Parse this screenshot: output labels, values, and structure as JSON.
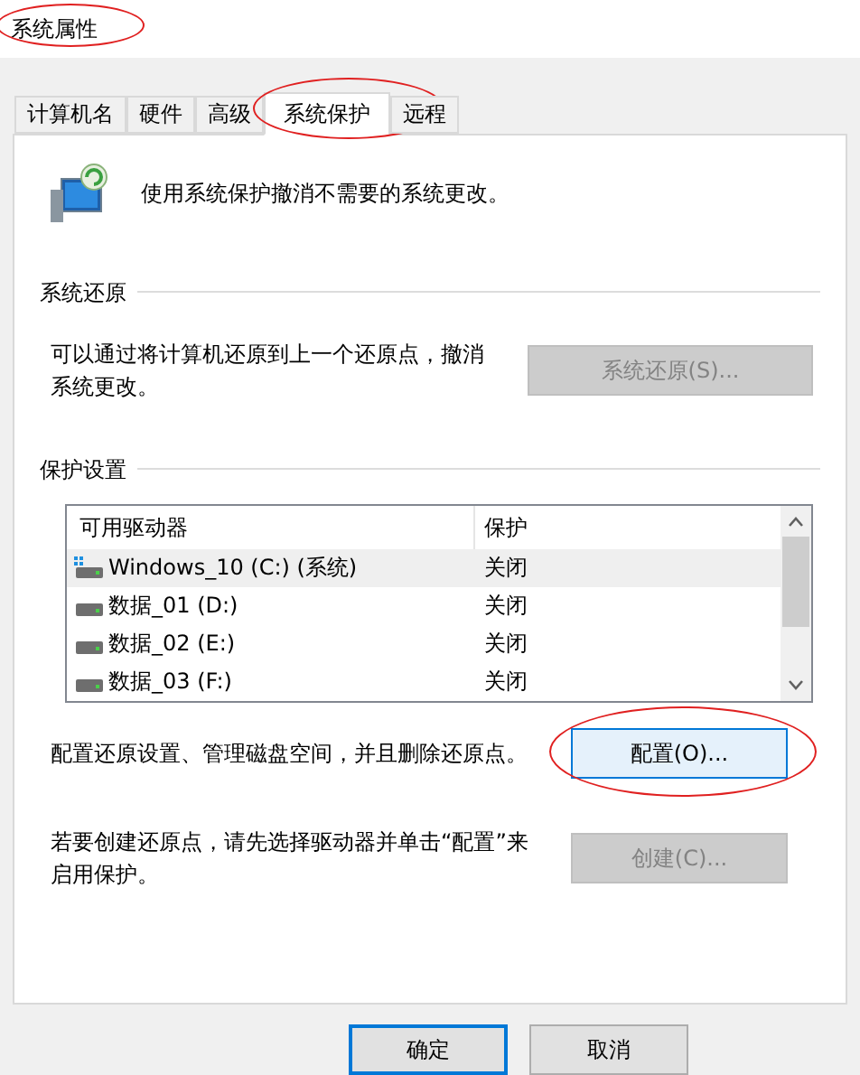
{
  "window": {
    "title": "系统属性",
    "circled": true
  },
  "tabs": [
    {
      "label": "计算机名",
      "selected": false,
      "circled": false
    },
    {
      "label": "硬件",
      "selected": false,
      "circled": false
    },
    {
      "label": "高级",
      "selected": false,
      "circled": false
    },
    {
      "label": "系统保护",
      "selected": true,
      "circled": true
    },
    {
      "label": "远程",
      "selected": false,
      "circled": false
    }
  ],
  "intro": "使用系统保护撤消不需要的系统更改。",
  "restore": {
    "heading": "系统还原",
    "text": "可以通过将计算机还原到上一个还原点，撤消系统更改。",
    "button": {
      "label": "系统还原(S)...",
      "disabled": true
    }
  },
  "protection": {
    "heading": "保护设置",
    "columns": [
      "可用驱动器",
      "保护"
    ],
    "rows": [
      {
        "kind": "system",
        "drive": "Windows_10 (C:) (系统)",
        "status": "关闭",
        "selected": true
      },
      {
        "kind": "data",
        "drive": "数据_01 (D:)",
        "status": "关闭",
        "selected": false
      },
      {
        "kind": "data",
        "drive": "数据_02 (E:)",
        "status": "关闭",
        "selected": false
      },
      {
        "kind": "data",
        "drive": "数据_03 (F:)",
        "status": "关闭",
        "selected": false
      }
    ],
    "configure_text": "配置还原设置、管理磁盘空间，并且删除还原点。",
    "configure_button": {
      "label": "配置(O)...",
      "disabled": false,
      "circled": true
    },
    "create_text": "若要创建还原点，请先选择驱动器并单击“配置”来启用保护。",
    "create_button": {
      "label": "创建(C)...",
      "disabled": true
    }
  },
  "buttons": [
    {
      "label": "确定",
      "default": true
    },
    {
      "label": "取消",
      "default": false
    }
  ]
}
